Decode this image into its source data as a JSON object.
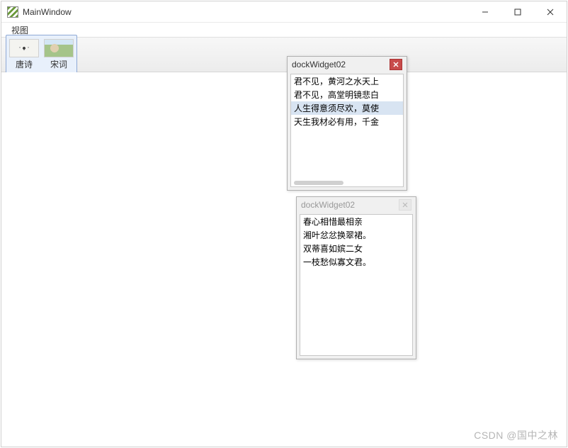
{
  "window": {
    "title": "MainWindow"
  },
  "menubar": {
    "items": [
      "视图"
    ]
  },
  "toolbar": {
    "buttons": [
      {
        "label": "唐诗",
        "icon": "poem-thumb"
      },
      {
        "label": "宋词",
        "icon": "ci-thumb"
      }
    ]
  },
  "dock1": {
    "title": "dockWidget02",
    "active": true,
    "lines": [
      "君不见，黄河之水天上",
      "君不见，高堂明镜悲白",
      "人生得意须尽欢，莫使",
      "天生我材必有用，千金"
    ],
    "selected_index": 2
  },
  "dock2": {
    "title": "dockWidget02",
    "active": false,
    "lines": [
      "春心相惜最相亲",
      "湘叶忿忿换翠裙。",
      "双蒂喜如嫔二女",
      "一枝愁似寡文君。"
    ],
    "selected_index": -1
  },
  "watermark": "CSDN @国中之林"
}
